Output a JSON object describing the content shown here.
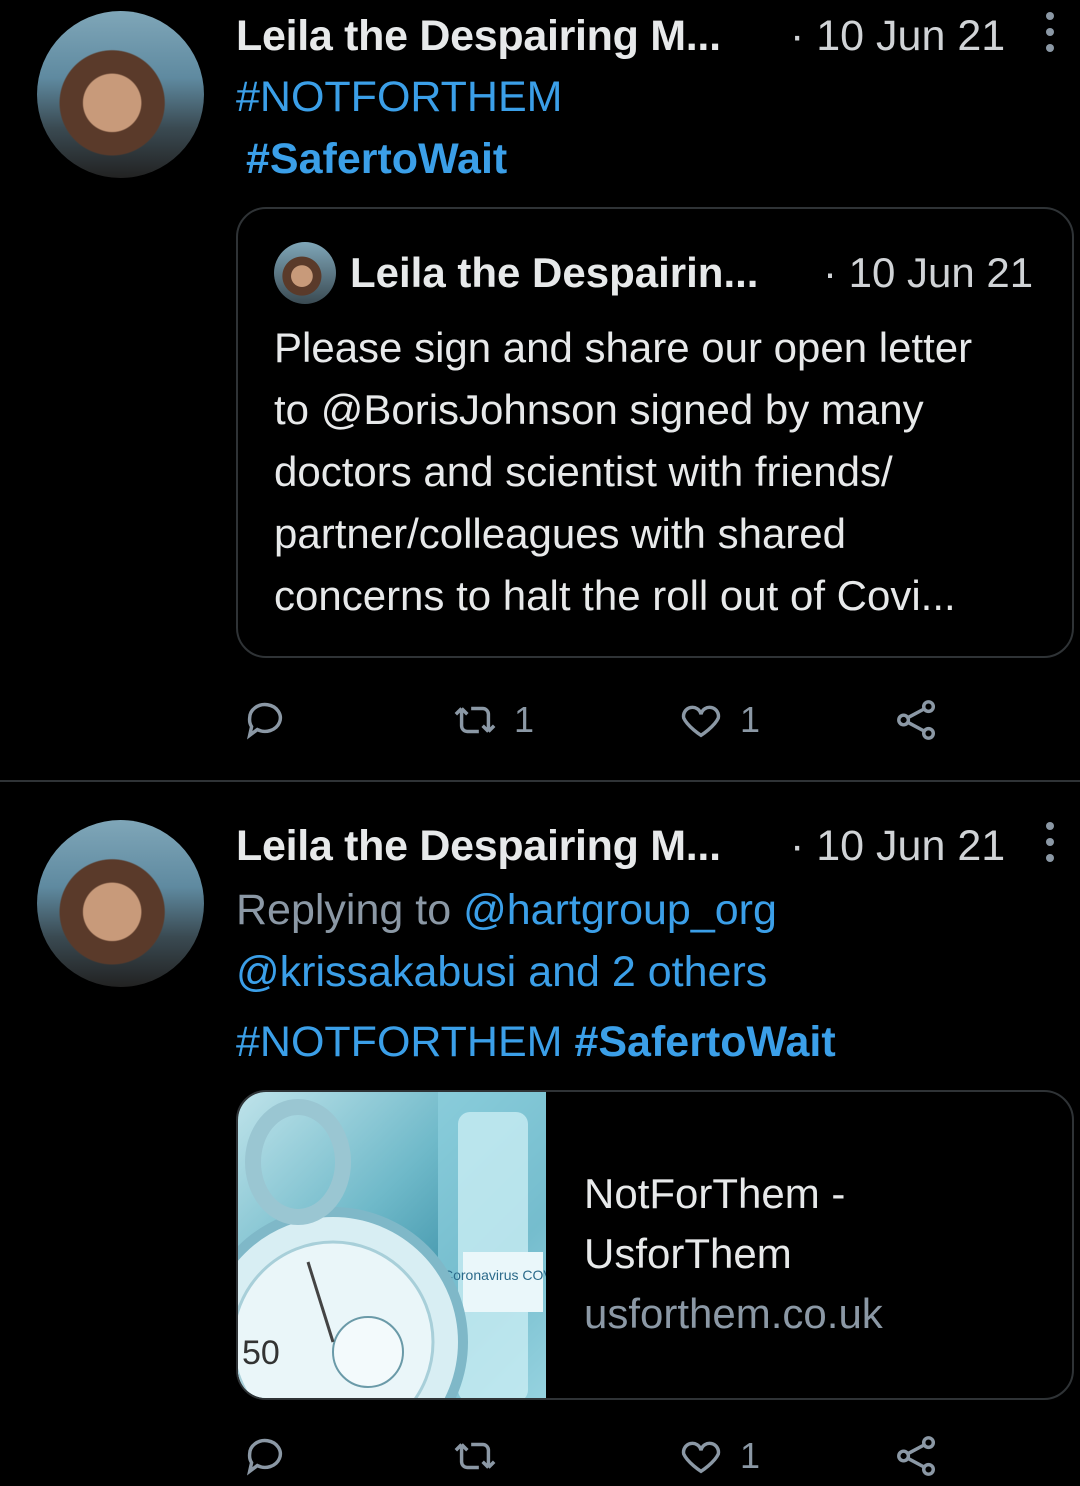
{
  "tweets": [
    {
      "author": "Leila the Despairing M...",
      "date": "· 10 Jun 21",
      "hashtag1": "#NOTFORTHEM",
      "hashtag2": "#SafertoWait",
      "quote": {
        "author": "Leila the Despairin...",
        "date": "· 10 Jun 21",
        "lines": [
          "Please sign and share our open letter",
          "to @BorisJohnson signed by many",
          "doctors and scientist with friends/",
          "partner/colleagues with shared",
          "concerns to halt the roll out of Covi..."
        ]
      },
      "retweets": "1",
      "likes": "1"
    },
    {
      "author": "Leila the Despairing M...",
      "date": "· 10 Jun 21",
      "replying_prefix": "Replying to",
      "replying_user1": "@hartgroup_org",
      "replying_user2": "@krissakabusi",
      "replying_suffix": "and 2 others",
      "hashtag1": "#NOTFORTHEM",
      "hashtag2": "#SafertoWait",
      "card": {
        "title_line1": "NotForThem -",
        "title_line2": "UsforThem",
        "domain": "usforthem.co.uk",
        "image_text": "Coronavirus COVID VACCINE",
        "image_number": "50"
      },
      "likes": "1"
    }
  ],
  "icons": {
    "reply": "reply-icon",
    "retweet": "retweet-icon",
    "like": "heart-icon",
    "share": "share-icon",
    "more": "more-options-icon"
  },
  "colors": {
    "background": "#000000",
    "link": "#3b9fe8",
    "muted": "#8b98a5",
    "border": "#2f3336"
  }
}
